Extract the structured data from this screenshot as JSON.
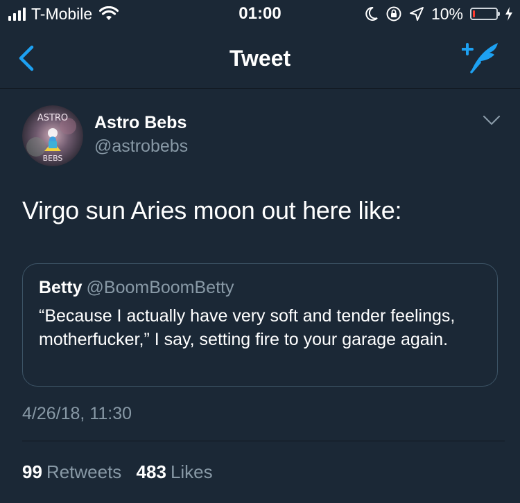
{
  "status_bar": {
    "carrier": "T-Mobile",
    "time": "01:00",
    "battery_percent": "10%",
    "battery_level": 0.1
  },
  "nav": {
    "title": "Tweet",
    "accent_color": "#1da1f2"
  },
  "tweet": {
    "avatar_text_top": "ASTRO",
    "avatar_text_bottom": "BEBS",
    "display_name": "Astro Bebs",
    "handle": "@astrobebs",
    "text": "Virgo sun Aries moon out here like:",
    "quoted": {
      "name": "Betty",
      "handle": "@BoomBoomBetty",
      "text": "“Because I actually have very soft and tender feelings, motherfucker,” I say, setting fire to your garage again."
    },
    "timestamp": "4/26/18, 11:30",
    "retweets_count": "99",
    "retweets_label": "Retweets",
    "likes_count": "483",
    "likes_label": "Likes"
  },
  "colors": {
    "background": "#1b2836",
    "secondary_text": "#8899a6",
    "border": "#3d5466"
  }
}
